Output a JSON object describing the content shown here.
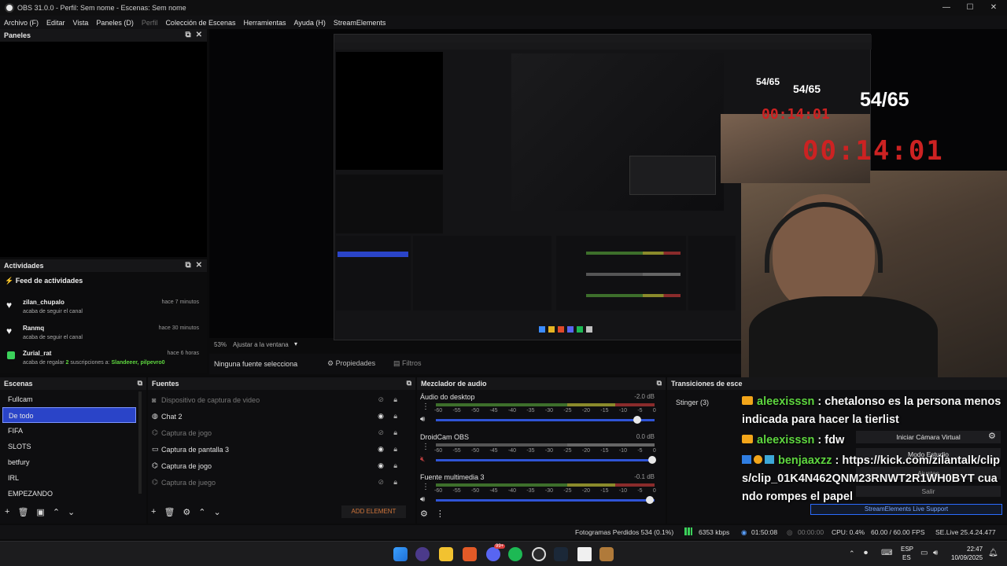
{
  "window": {
    "title": "OBS 31.0.0 - Perfil: Sem nome - Escenas: Sem nome"
  },
  "menu": {
    "items": [
      "Archivo (F)",
      "Editar",
      "Vista",
      "Paneles (D)",
      "Perfil",
      "Colección de Escenas",
      "Herramientas",
      "Ayuda (H)",
      "StreamElements"
    ]
  },
  "panels_dock": {
    "title": "Paneles"
  },
  "activity_dock": {
    "title": "Actividades",
    "feed_title": "Feed de actividades",
    "items": [
      {
        "name": "zilan_chupalo",
        "desc": "acaba de seguir el canal",
        "time": "hace 7 minutos"
      },
      {
        "name": "Ranmq",
        "desc": "acaba de seguir el canal",
        "time": "hace 30 minutos"
      },
      {
        "name": "Zurial_rat",
        "desc_pre": "acaba de regalar ",
        "count": "2",
        "desc_mid": " suscripciones a: ",
        "recipients": "Slandeeer, pilpevro0",
        "time": "hace 6 horas"
      }
    ]
  },
  "preview_bar": {
    "zoom": "53%",
    "fit": "Ajustar a la ventana",
    "no_source": "Ninguna fuente selecciona",
    "properties": "Propiedades",
    "filters": "Filtros"
  },
  "overlay": {
    "counter_small": "54/65",
    "counter_big": "54/65",
    "timer_small": "00:14:01",
    "timer_big": "00:14:01"
  },
  "scenes": {
    "title": "Escenas",
    "items": [
      "Fullcam",
      "De todo",
      "FIFA",
      "SLOTS",
      "betfury",
      "IRL",
      "EMPEZANDO"
    ],
    "selected_index": 1
  },
  "sources": {
    "title": "Fuentes",
    "items": [
      {
        "label": "Dispositivo de captura de video",
        "visible": false
      },
      {
        "label": "Chat 2",
        "visible": true
      },
      {
        "label": "Captura de jogo",
        "visible": false
      },
      {
        "label": "Captura de pantalla 3",
        "visible": true
      },
      {
        "label": "Captura de jogo",
        "visible": true
      },
      {
        "label": "Captura de juego",
        "visible": false
      }
    ],
    "add_element": "ADD ELEMENT"
  },
  "mixer": {
    "title": "Mezclador de audio",
    "channels": [
      {
        "name": "Áudio do desktop",
        "db": "-2.0 dB",
        "level": 0.93
      },
      {
        "name": "DroidCam OBS",
        "db": "0.0 dB",
        "level": 1.0
      },
      {
        "name": "Fuente multimedia 3",
        "db": "-0.1 dB",
        "level": 0.99
      }
    ],
    "ticks": [
      "-60",
      "-55",
      "-50",
      "-45",
      "-40",
      "-35",
      "-30",
      "-25",
      "-20",
      "-15",
      "-10",
      "-5",
      "0"
    ]
  },
  "transitions": {
    "title": "Transiciones de esce",
    "selected": "Stinger (3)"
  },
  "controls": {
    "virtual_cam": "Iniciar Cámara Virtual",
    "studio_mode": "Modo Estudio",
    "settings": "Ajustes",
    "exit": "Salir",
    "support": "StreamElements Live Support"
  },
  "chat": [
    {
      "user": "aleexisssn",
      "text": " : chetalonso es la persona menos indicada para hacer la tierlist"
    },
    {
      "user": "aleexisssn",
      "text": " : fdw"
    },
    {
      "user": "benjaaxzz",
      "text": " : https://kick.com/zilantalk/clips/clip_01K4N462QNM23RNWT2R1WH0BYT cuando rompes el papel"
    }
  ],
  "statusbar": {
    "dropped": "Fotogramas Perdidos 534 (0.1%)",
    "bitrate": "6353 kbps",
    "stream_time": "01:50:08",
    "rec_time": "00:00:00",
    "cpu": "CPU: 0.4%",
    "fps": "60.00 / 60.00 FPS",
    "version": "SE.Live 25.4.24.477"
  },
  "taskbar": {
    "lang": "ESP",
    "region": "ES",
    "time": "22:47",
    "date": "10/09/2025",
    "badge": "99+"
  },
  "colors": {
    "accent": "#2a44c8",
    "chat_user": "#5ed63f",
    "streamelements_blue": "#2b6cff"
  }
}
